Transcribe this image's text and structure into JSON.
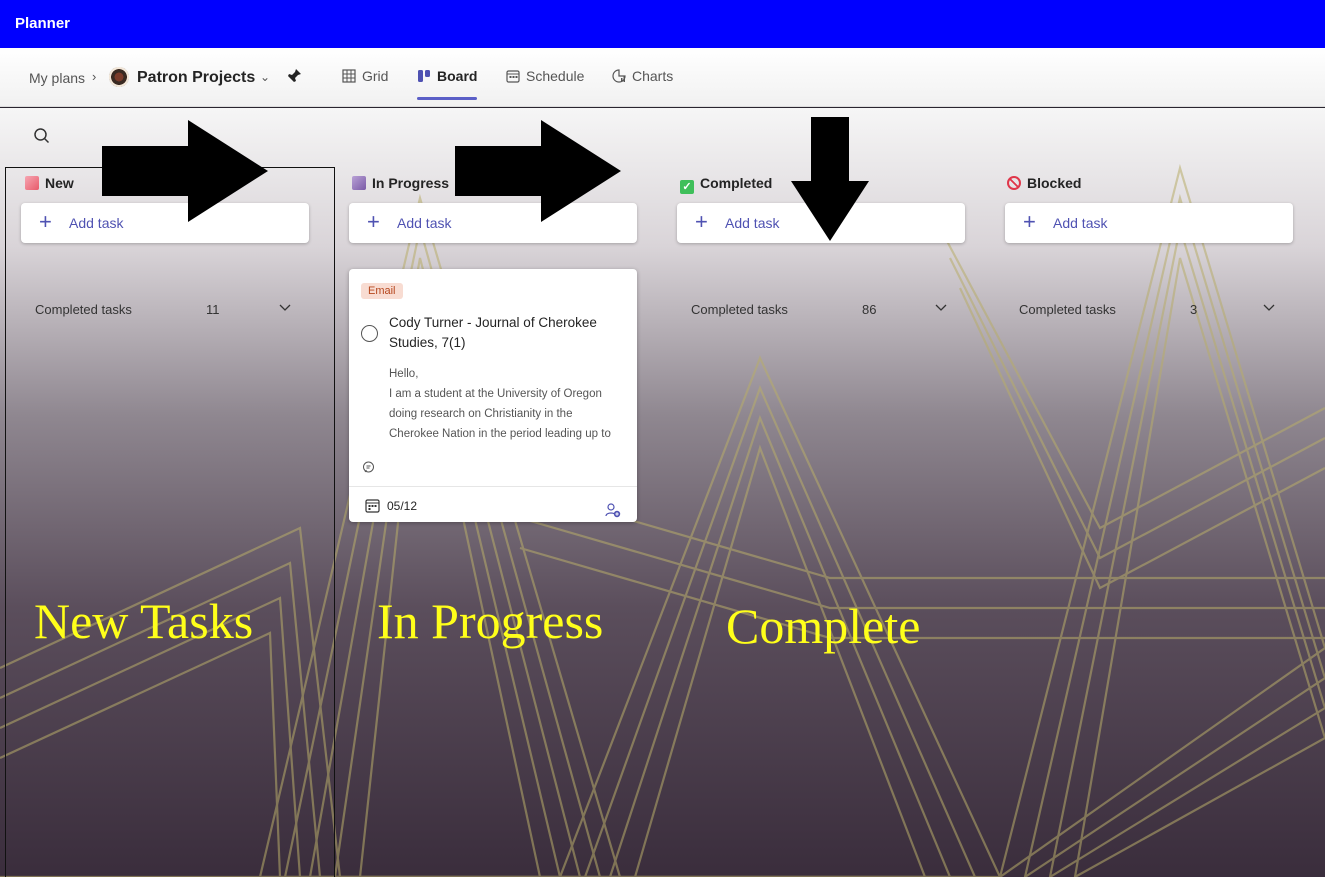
{
  "app": {
    "title": "Planner"
  },
  "header": {
    "breadcrumb_root": "My plans",
    "plan_name": "Patron Projects",
    "tabs": [
      {
        "label": "Grid",
        "icon": "grid-icon"
      },
      {
        "label": "Board",
        "icon": "board-icon",
        "active": true
      },
      {
        "label": "Schedule",
        "icon": "schedule-icon"
      },
      {
        "label": "Charts",
        "icon": "charts-icon"
      }
    ]
  },
  "board": {
    "add_task_label": "Add task",
    "completed_label": "Completed tasks",
    "columns": [
      {
        "title": "New",
        "completed_count": "11",
        "icon": "paint-icon"
      },
      {
        "title": "In Progress",
        "icon": "hammer-icon"
      },
      {
        "title": "Completed",
        "completed_count": "86",
        "icon": "check-box-icon"
      },
      {
        "title": "Blocked",
        "completed_count": "3",
        "icon": "blocked-icon"
      }
    ],
    "task": {
      "label": "Email",
      "title": "Cody Turner - Journal of Cherokee Studies, 7(1)",
      "preview": [
        "Hello,",
        "I am a student at the University of Oregon",
        "doing research on Christianity in the",
        "Cherokee Nation in the period leading up to"
      ],
      "due": "05/12"
    }
  },
  "annotations": [
    "New Tasks",
    "In Progress",
    "Complete"
  ],
  "colors": {
    "appbar": "#0000ff",
    "accent": "#5b5fc7",
    "annotation": "#ffff1a"
  }
}
